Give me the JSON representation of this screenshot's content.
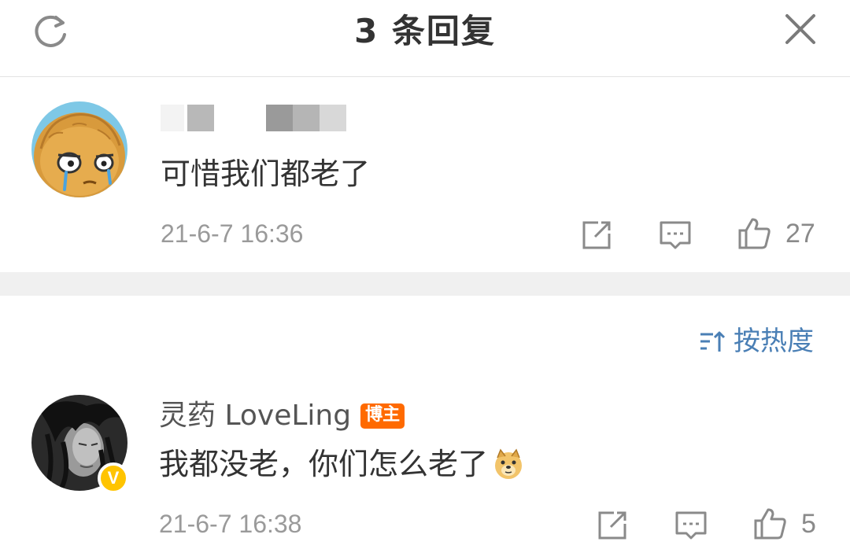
{
  "header": {
    "title": "3 条回复",
    "refresh_icon": "refresh-icon",
    "close_icon": "close-icon"
  },
  "comments": [
    {
      "avatar": "cartoon-nut-avatar",
      "name_blurred": true,
      "text": "可惜我们都老了",
      "time": "21-6-7 16:36",
      "likes": "27"
    },
    {
      "avatar": "dark-hair-portrait-avatar",
      "name": "灵药 LoveLing",
      "badge": "博主",
      "verified": "V",
      "text": "我都没老，你们怎么老了",
      "emoji": "doge-emoji",
      "time": "21-6-7 16:38",
      "likes": "5"
    }
  ],
  "sort": {
    "label": "按热度",
    "icon": "sort-icon"
  },
  "colors": {
    "accent_blue": "#4a7fb5",
    "badge_orange": "#ff6a00",
    "verified_yellow": "#ffc400",
    "timestamp_gray": "#9a9a9a",
    "band_gray": "#f0f0f0"
  }
}
